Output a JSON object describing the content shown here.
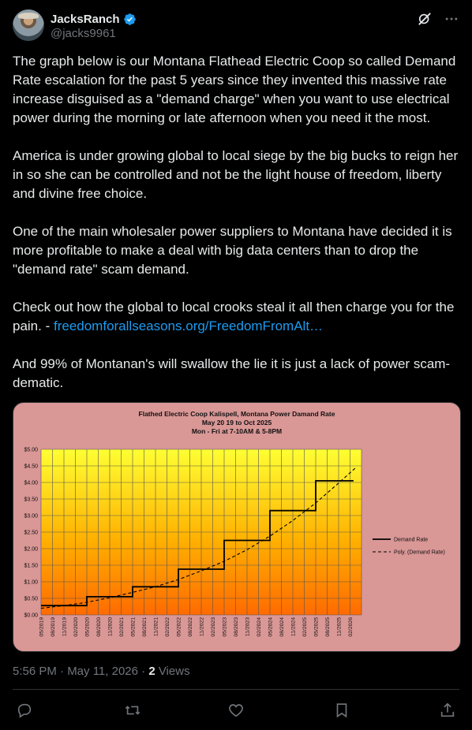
{
  "author": {
    "display_name": "JacksRanch",
    "handle": "@jacks9961"
  },
  "tweet": {
    "p1": "The graph below is our Montana Flathead Electric Coop so called Demand Rate escalation  for the past 5 years since they invented this massive rate increase disguised as a \"demand charge\" when you want to use electrical power during the morning or late afternoon when you need it the most.",
    "p2": "America is under growing global to local siege by the big bucks to reign her in so she can be controlled and not be the light house of freedom, liberty and divine free choice.",
    "p3": "One of the main wholesaler power suppliers  to Montana have decided it is more profitable to make a deal with big data centers than to drop the \"demand rate\" scam demand.",
    "p4_text": "Check out how the global to local crooks steal it all then charge you for the pain. - ",
    "p4_link": "freedomforallseasons.org/FreedomFromAlt…",
    "p5": "And 99% of Montanan's will swallow the lie it is just a lack of power scam-dematic."
  },
  "meta": {
    "timestamp": "5:56 PM · May 11, 2026 · ",
    "views_count": "2",
    "views_label": " Views"
  },
  "actions": [
    "reply-icon",
    "repost-icon",
    "like-icon",
    "bookmark-icon",
    "share-icon"
  ],
  "colors": {
    "accent": "#1d9bf0",
    "chart_bg": "#d99796",
    "plot_top": "#ffff33",
    "plot_bottom": "#ff6a00"
  },
  "chart_data": {
    "type": "line",
    "title_lines": [
      "Flathed Electric Coop  Kalispell, Montana Power Damand Rate",
      "May 20 19 to Oct 2025",
      "Mon - Fri at 7-10AM & 5-8PM"
    ],
    "ylim": [
      0,
      5
    ],
    "y_ticks": [
      "$0.00",
      "$0.50",
      "$1.00",
      "$1.50",
      "$2.00",
      "$2.50",
      "$3.00",
      "$3.50",
      "$4.00",
      "$4.50",
      "$5.00"
    ],
    "x_ticks": [
      "05/2019",
      "08/2019",
      "11/2019",
      "02/2020",
      "05/2020",
      "08/2020",
      "11/2020",
      "02/2021",
      "05/2021",
      "08/2021",
      "11/2021",
      "02/2022",
      "05/2022",
      "08/2022",
      "11/2022",
      "02/2023",
      "05/2023",
      "08/2023",
      "11/2023",
      "02/2024",
      "05/2024",
      "08/2024",
      "11/2024",
      "02/2025",
      "05/2025",
      "08/2025",
      "11/2025",
      "02/2026"
    ],
    "series": [
      {
        "name": "Demand Rate",
        "style": "solid",
        "x": [
          0,
          4,
          4,
          8,
          8,
          12,
          12,
          16,
          16,
          20,
          20,
          24,
          24,
          27.3
        ],
        "y": [
          0.28,
          0.28,
          0.55,
          0.55,
          0.85,
          0.85,
          1.38,
          1.38,
          2.25,
          2.25,
          3.15,
          3.15,
          4.05,
          4.05
        ]
      },
      {
        "name": "Poly. (Demand  Rate)",
        "style": "dashed",
        "x": [
          0,
          2,
          4,
          6,
          8,
          10,
          12,
          14,
          16,
          18,
          20,
          22,
          24,
          26,
          27.5
        ],
        "y": [
          0.2,
          0.28,
          0.38,
          0.52,
          0.68,
          0.85,
          1.07,
          1.33,
          1.62,
          1.97,
          2.38,
          2.85,
          3.38,
          3.98,
          4.45
        ]
      }
    ],
    "legend_position": "right",
    "grid": true
  }
}
